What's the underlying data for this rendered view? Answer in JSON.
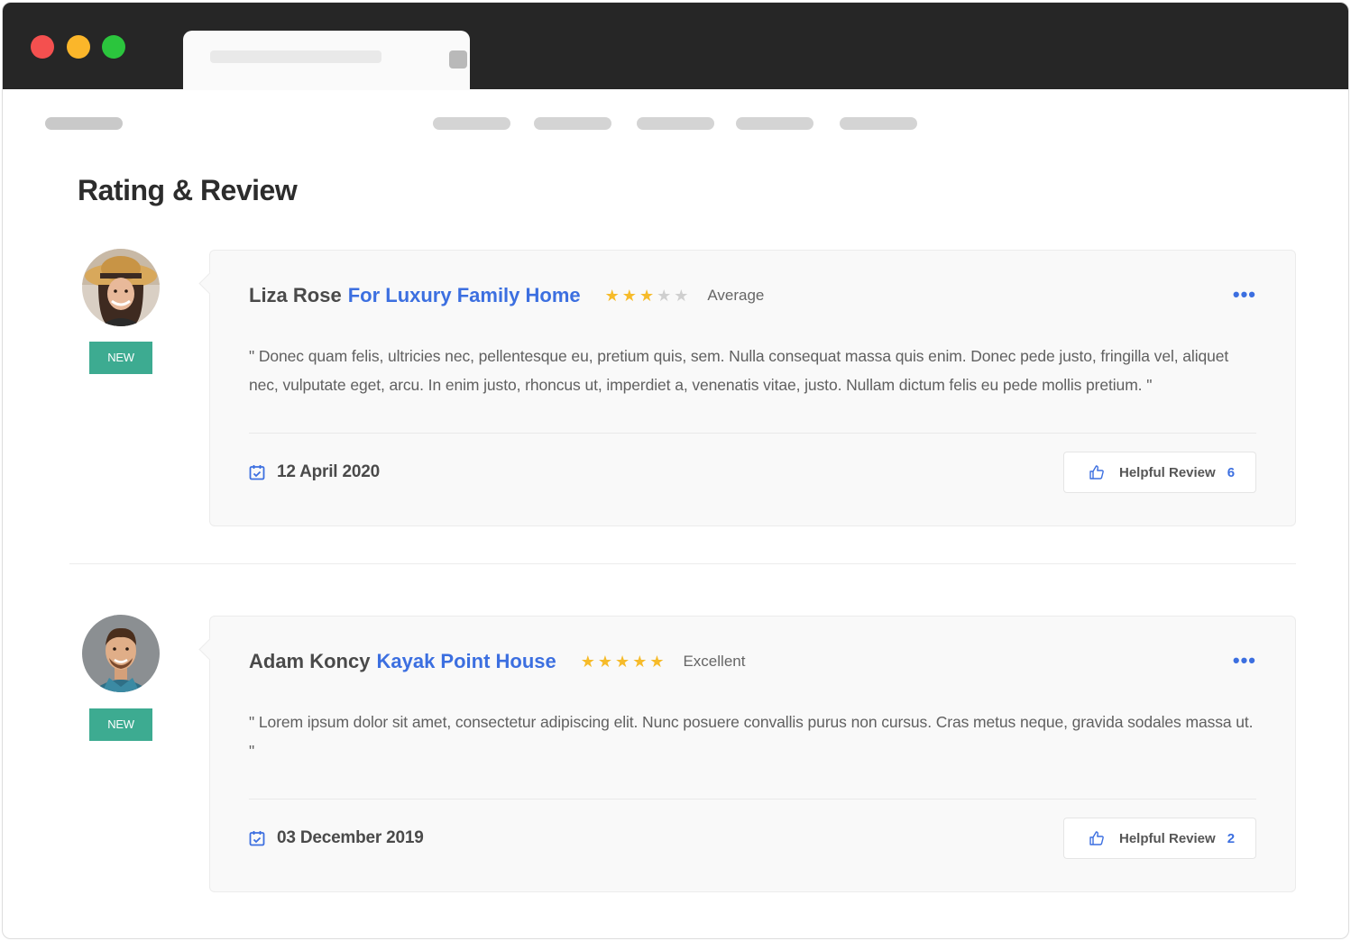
{
  "page": {
    "title": "Rating & Review"
  },
  "colors": {
    "accent": "#3c6fe0",
    "badge": "#3dab91",
    "star": "#f6bb2a",
    "star_empty": "#cfcfcf"
  },
  "reviews": [
    {
      "name": "Liza Rose",
      "property": "For Luxury Family Home",
      "rating": 3,
      "max_rating": 5,
      "rating_label": "Average",
      "badge": "NEW",
      "text": "\" Donec quam felis, ultricies nec, pellentesque eu, pretium quis, sem. Nulla consequat massa quis enim. Donec pede justo, fringilla vel, aliquet nec, vulputate eget, arcu. In enim justo, rhoncus ut, imperdiet a, venenatis vitae, justo. Nullam dictum felis eu pede mollis pretium. \"",
      "date": "12 April 2020",
      "helpful_label": "Helpful Review",
      "helpful_count": "6",
      "more": "•••"
    },
    {
      "name": "Adam Koncy",
      "property": "Kayak Point House",
      "rating": 5,
      "max_rating": 5,
      "rating_label": "Excellent",
      "badge": "NEW",
      "text": "\" Lorem ipsum dolor sit amet, consectetur adipiscing elit. Nunc posuere convallis purus non cursus. Cras metus neque, gravida sodales massa ut. \"",
      "date": "03 December 2019",
      "helpful_label": "Helpful Review",
      "helpful_count": "2",
      "more": "•••"
    }
  ]
}
